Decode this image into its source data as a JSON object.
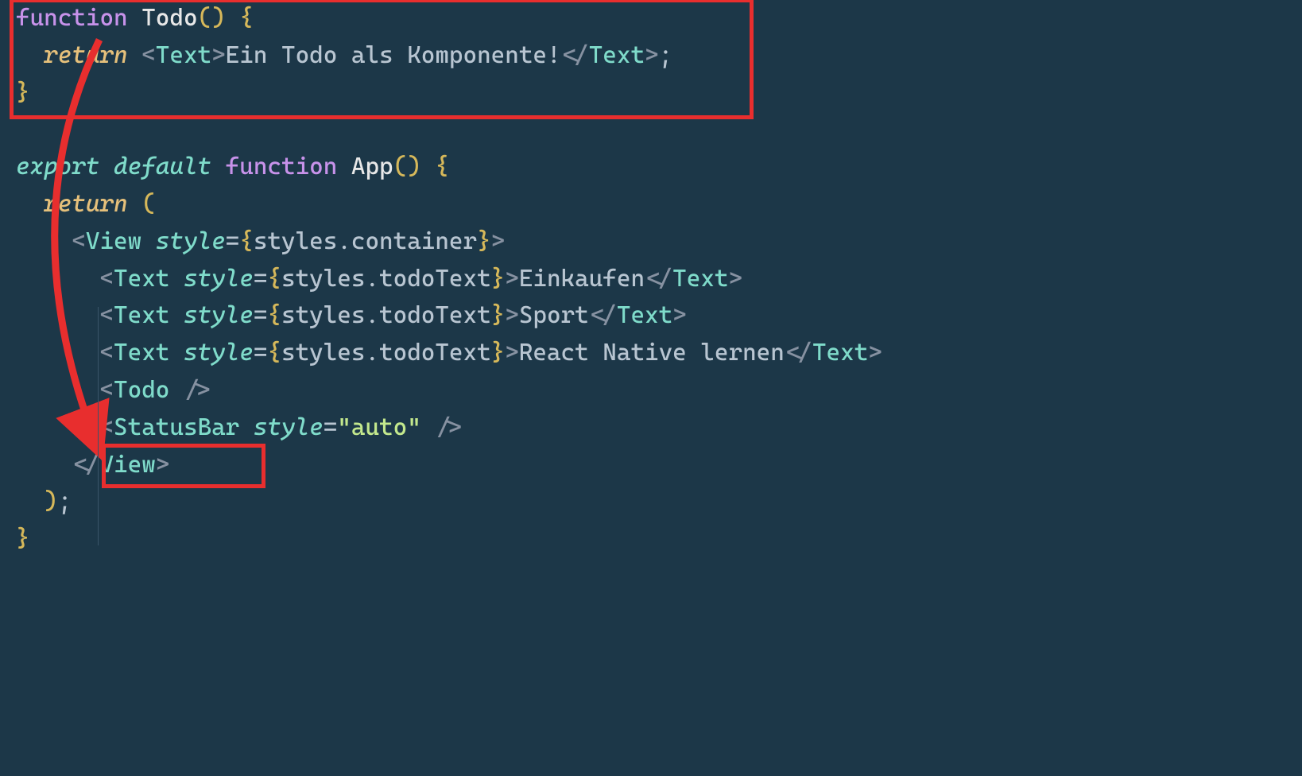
{
  "code": {
    "line1": {
      "function_kw": "function",
      "fn_name": "Todo",
      "parens": "()",
      "space": " ",
      "brace_open": "{"
    },
    "line2": {
      "indent": "  ",
      "return_kw": "return",
      "space": " ",
      "tag_open": "<",
      "tag_name": "Text",
      "tag_close": ">",
      "text_content": "Ein Todo als Komponente!",
      "tag_close_open": "</",
      "tag_name2": "Text",
      "tag_close2": ">",
      "semicolon": ";"
    },
    "line3": {
      "brace_close": "}"
    },
    "line5": {
      "export_kw": "export",
      "default_kw": "default",
      "function_kw": "function",
      "fn_name": "App",
      "parens": "()",
      "brace_open": "{"
    },
    "line6": {
      "return_kw": "return",
      "paren_open": "("
    },
    "line7": {
      "tag_open": "<",
      "tag_name": "View",
      "attr_name": "style",
      "equals": "=",
      "brace_open": "{",
      "obj": "styles.container",
      "brace_close": "}",
      "tag_close": ">"
    },
    "line8": {
      "tag_open": "<",
      "tag_name": "Text",
      "attr_name": "style",
      "equals": "=",
      "brace_open": "{",
      "obj": "styles.todoText",
      "brace_close": "}",
      "tag_close": ">",
      "text_content": "Einkaufen",
      "tag_close_open": "</",
      "tag_name2": "Text",
      "tag_close2": ">"
    },
    "line9": {
      "tag_open": "<",
      "tag_name": "Text",
      "attr_name": "style",
      "equals": "=",
      "brace_open": "{",
      "obj": "styles.todoText",
      "brace_close": "}",
      "tag_close": ">",
      "text_content": "Sport",
      "tag_close_open": "</",
      "tag_name2": "Text",
      "tag_close2": ">"
    },
    "line10": {
      "tag_open": "<",
      "tag_name": "Text",
      "attr_name": "style",
      "equals": "=",
      "brace_open": "{",
      "obj": "styles.todoText",
      "brace_close": "}",
      "tag_close": ">",
      "text_content": "React Native lernen",
      "tag_close_open": "</",
      "tag_name2": "Text",
      "tag_close2": ">"
    },
    "line11": {
      "tag_open": "<",
      "tag_name": "Todo",
      "self_close": " />"
    },
    "line12": {
      "tag_open": "<",
      "tag_name": "StatusBar",
      "attr_name": "style",
      "equals": "=",
      "string_val": "\"auto\"",
      "self_close": " />"
    },
    "line13": {
      "tag_close_open": "</",
      "tag_name": "View",
      "tag_close": ">"
    },
    "line14": {
      "paren_close": ")",
      "semicolon": ";"
    },
    "line15": {
      "brace_close": "}"
    }
  },
  "annotations": {
    "box1": "todo-function-definition",
    "box2": "todo-component-usage",
    "arrow": "definition-to-usage-arrow"
  }
}
